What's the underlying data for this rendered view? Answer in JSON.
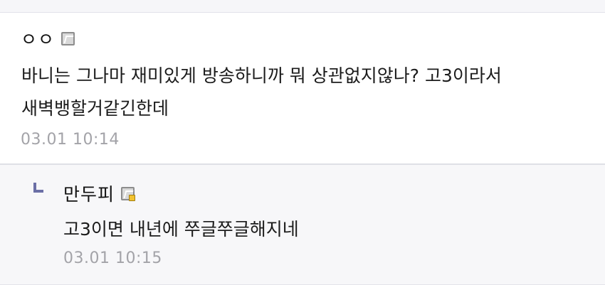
{
  "comment": {
    "nickname": "ㅇㅇ",
    "badge_icon": "member-grade-icon",
    "text_line1": "바니는 그나마 재미있게 방송하니까 뭐 상관없지않나? 고3이라서",
    "text_line2": "새벽뱅할거같긴한데",
    "timestamp": "03.01 10:14"
  },
  "reply": {
    "reply_icon": "reply-arrow-icon",
    "nickname": "만두피",
    "badge_icon": "member-grade-gold-icon",
    "text": "고3이면 내년에 쭈글쭈글해지네",
    "timestamp": "03.01 10:15"
  }
}
